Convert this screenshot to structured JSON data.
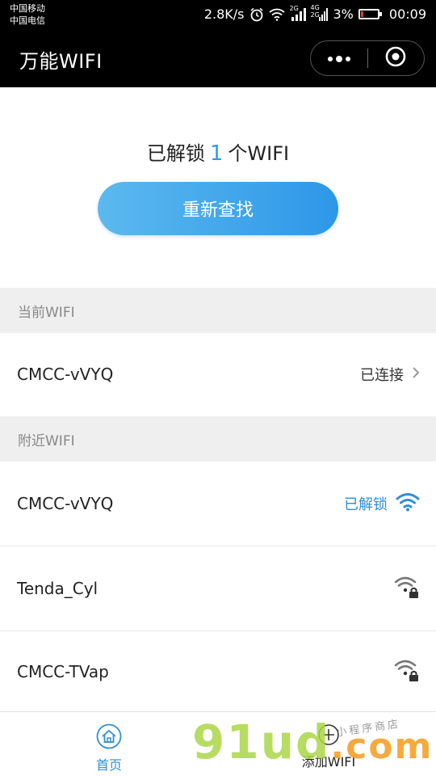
{
  "status_bar": {
    "carrier_1": "中国移动",
    "carrier_2": "中国电信",
    "speed": "2.8K/s",
    "network_1": "2G",
    "network_2a": "4G",
    "network_2b": "2G",
    "battery": "3%",
    "time": "00:09"
  },
  "title_bar": {
    "title": "万能WIFI"
  },
  "hero": {
    "prefix": "已解锁",
    "count": "1",
    "suffix": "个WIFI",
    "rescan_label": "重新查找"
  },
  "current_section": {
    "header": "当前WIFI",
    "ssid": "CMCC-vVYQ",
    "state": "已连接"
  },
  "nearby_section": {
    "header": "附近WIFI",
    "items": [
      {
        "ssid": "CMCC-vVYQ",
        "state": "已解锁",
        "icon": "wifi-unlocked-icon"
      },
      {
        "ssid": "Tenda_Cyl",
        "state": "",
        "icon": "wifi-locked-icon"
      },
      {
        "ssid": "CMCC-TVap",
        "state": "",
        "icon": "wifi-locked-icon"
      }
    ]
  },
  "tab_bar": {
    "tabs": [
      {
        "label": "首页",
        "icon": "home-icon",
        "active": true
      },
      {
        "label": "添加WIFI",
        "icon": "plus-circle-icon",
        "active": false
      }
    ]
  },
  "watermark": {
    "logo_text": "91ud",
    "logo_suffix": ".com",
    "sub_text": "小程序商店"
  },
  "colors": {
    "accent": "#2f8fd3",
    "button_gradient_start": "#5cb9ef",
    "button_gradient_end": "#2d97e8",
    "header_bg": "#000000",
    "section_bg": "#efefef"
  }
}
